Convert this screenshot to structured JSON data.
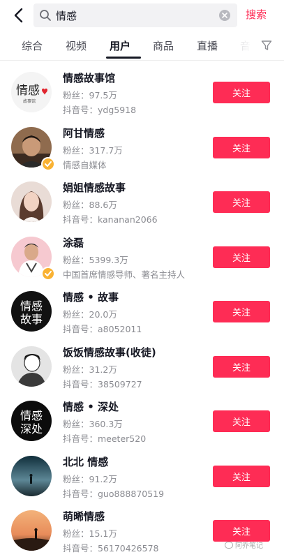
{
  "search": {
    "query": "情感",
    "submit_label": "搜索"
  },
  "tabs": [
    {
      "label": "综合"
    },
    {
      "label": "视频"
    },
    {
      "label": "用户"
    },
    {
      "label": "商品"
    },
    {
      "label": "直播"
    },
    {
      "label": "音"
    }
  ],
  "active_tab": "用户",
  "follow_label": "关注",
  "accent_color": "#fe2c55",
  "users": [
    {
      "name": "情感故事馆",
      "line1": "粉丝：97.5万",
      "line2": "抖音号：ydg5918",
      "avatar_text": "情感",
      "avatar_sub": "故事馆"
    },
    {
      "name": "阿甘情感",
      "line1": "粉丝：317.7万",
      "line2": "情感自媒体",
      "verified": true
    },
    {
      "name": "娟姐情感故事",
      "line1": "粉丝：88.6万",
      "line2": "抖音号：kananan2066"
    },
    {
      "name": "涂磊",
      "line1": "粉丝：5399.3万",
      "line2": "中国首席情感导师、著名主持人",
      "verified": true
    },
    {
      "name": "情感 • 故事",
      "line1": "粉丝：20.0万",
      "line2": "抖音号：a8052011",
      "avatar_text": "情感",
      "avatar_sub": "故事"
    },
    {
      "name": "饭饭情感故事(收徒)",
      "line1": "粉丝：31.2万",
      "line2": "抖音号：38509727"
    },
    {
      "name": "情感 • 深处",
      "line1": "粉丝：360.3万",
      "line2": "抖音号：meeter520",
      "avatar_text": "情感",
      "avatar_sub": "深处"
    },
    {
      "name": "北北 情感",
      "line1": "粉丝：91.2万",
      "line2": "抖音号：guo888870519"
    },
    {
      "name": "萌晞情感",
      "line1": "粉丝：15.1万",
      "line2": "抖音号：56170426578"
    }
  ],
  "watermark": "阿乔笔记"
}
